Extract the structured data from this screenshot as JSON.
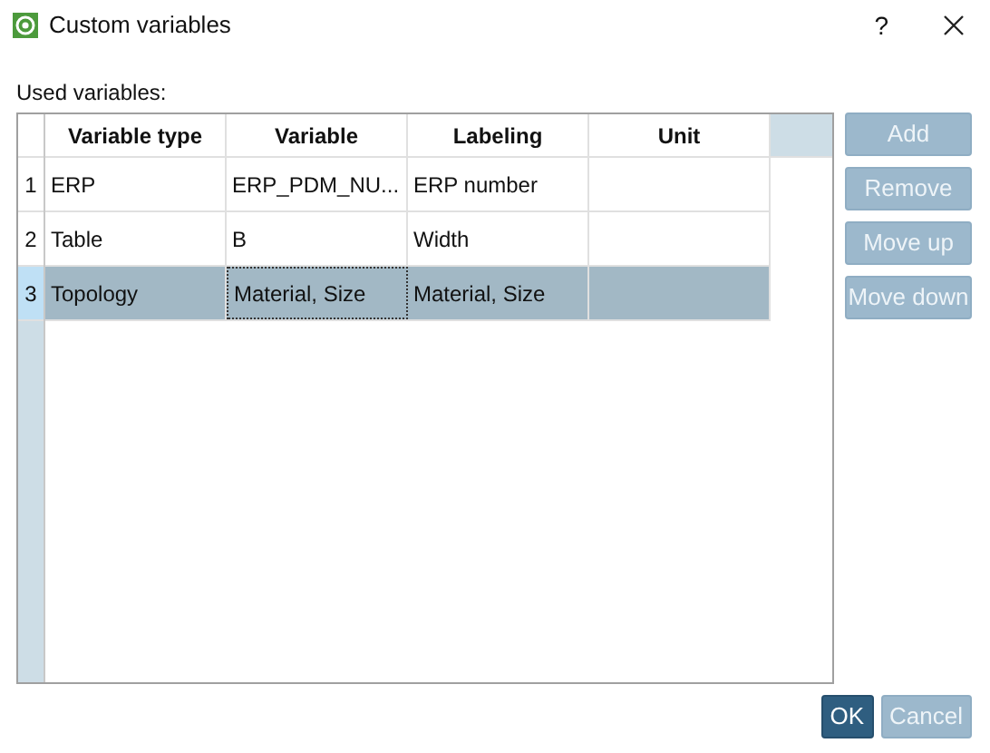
{
  "window": {
    "title": "Custom variables",
    "help": "?"
  },
  "label": "Used variables:",
  "table": {
    "columns": [
      "Variable type",
      "Variable",
      "Labeling",
      "Unit"
    ],
    "rows": [
      {
        "number": "1",
        "cells": [
          "ERP",
          "ERP_PDM_NU...",
          "ERP number",
          ""
        ],
        "selected": false
      },
      {
        "number": "2",
        "cells": [
          "Table",
          "B",
          "Width",
          ""
        ],
        "selected": false
      },
      {
        "number": "3",
        "cells": [
          "Topology",
          "Material, Size",
          "Material, Size",
          ""
        ],
        "selected": true
      }
    ]
  },
  "side_buttons": [
    {
      "label": "Add",
      "disabled": true
    },
    {
      "label": "Remove",
      "disabled": true
    },
    {
      "label": "Move up",
      "disabled": true
    },
    {
      "label": "Move down",
      "disabled": true
    }
  ],
  "footer_buttons": [
    {
      "label": "OK",
      "disabled": false
    },
    {
      "label": "Cancel",
      "disabled": true
    }
  ]
}
